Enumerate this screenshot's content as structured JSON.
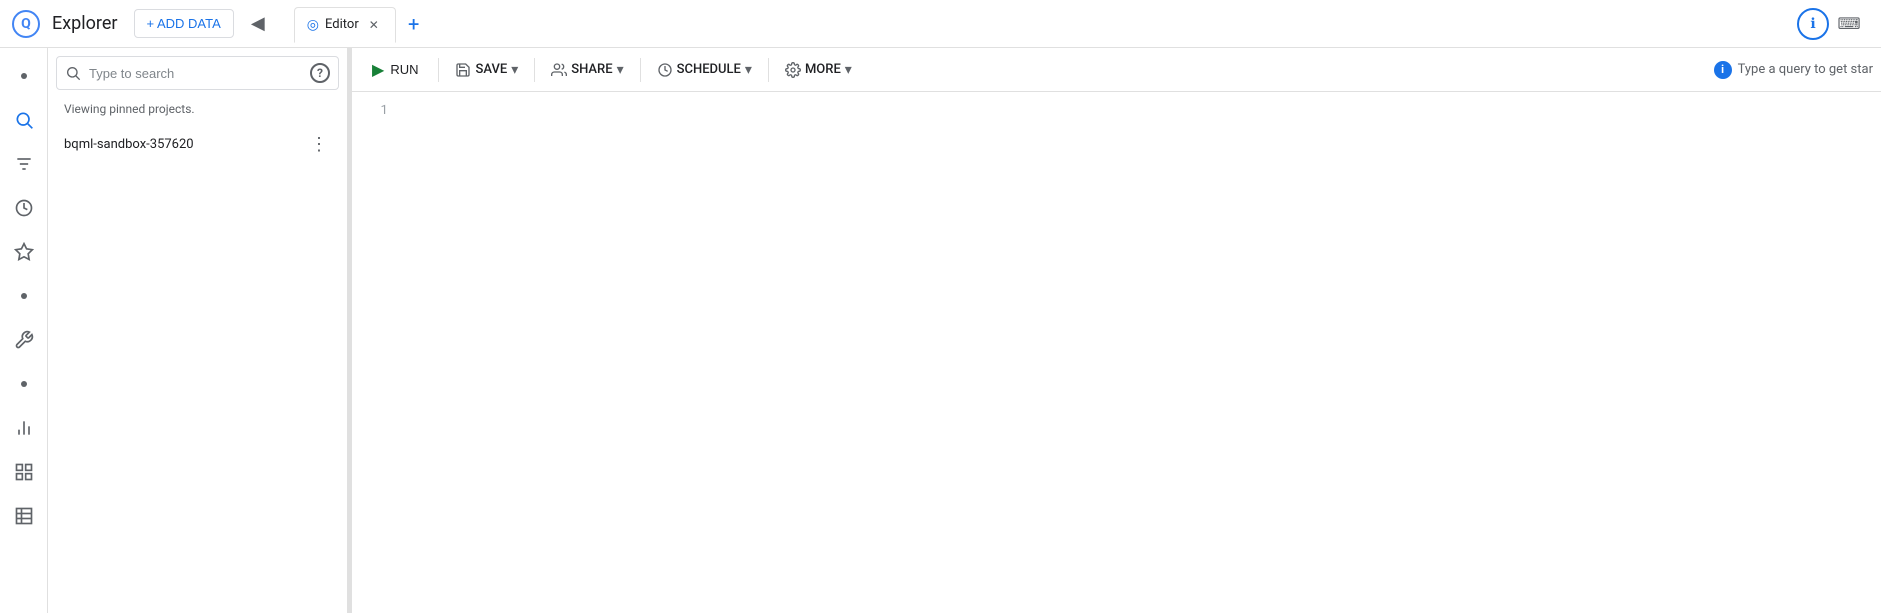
{
  "header": {
    "logo_symbol": "Q",
    "title": "Explorer",
    "add_data_label": "+ ADD DATA",
    "collapse_symbol": "◀"
  },
  "tabs": [
    {
      "id": "editor",
      "label": "Editor",
      "icon": "◎",
      "active": true,
      "closable": true,
      "close_symbol": "✕"
    }
  ],
  "new_tab_symbol": "+",
  "left_nav": {
    "items": [
      {
        "id": "dot1",
        "type": "dot"
      },
      {
        "id": "search",
        "type": "search",
        "symbol": "🔍",
        "active": true
      },
      {
        "id": "filter",
        "type": "filter",
        "symbol": "≡"
      },
      {
        "id": "history",
        "type": "history",
        "symbol": "⏱"
      },
      {
        "id": "starred",
        "type": "starred",
        "symbol": "✦"
      },
      {
        "id": "dot2",
        "type": "dot"
      },
      {
        "id": "wrench",
        "type": "wrench",
        "symbol": "🔧"
      },
      {
        "id": "dot3",
        "type": "dot"
      },
      {
        "id": "chart",
        "type": "chart",
        "symbol": "📊"
      },
      {
        "id": "table",
        "type": "table",
        "symbol": "⊞"
      },
      {
        "id": "grid",
        "type": "grid",
        "symbol": "▦"
      }
    ]
  },
  "explorer": {
    "search_placeholder": "Type to search",
    "help_symbol": "?",
    "pinned_label": "Viewing pinned projects.",
    "projects": [
      {
        "name": "bqml-sandbox-357620",
        "more_symbol": "⋮"
      }
    ]
  },
  "toolbar": {
    "run_label": "RUN",
    "run_icon": "▶",
    "save_label": "SAVE",
    "save_icon": "💾",
    "save_dropdown": "▾",
    "share_label": "SHARE",
    "share_icon": "👤+",
    "share_dropdown": "▾",
    "schedule_label": "SCHEDULE",
    "schedule_icon": "⏱",
    "schedule_dropdown": "▾",
    "more_label": "MORE",
    "more_icon": "⚙",
    "more_dropdown": "▾",
    "query_hint": "Type a query to get star"
  },
  "editor": {
    "line_number": "1",
    "content": ""
  },
  "top_right_icons": [
    {
      "id": "info",
      "symbol": "ℹ",
      "color": "#1a73e8"
    },
    {
      "id": "keyboard",
      "symbol": "⌨"
    }
  ]
}
